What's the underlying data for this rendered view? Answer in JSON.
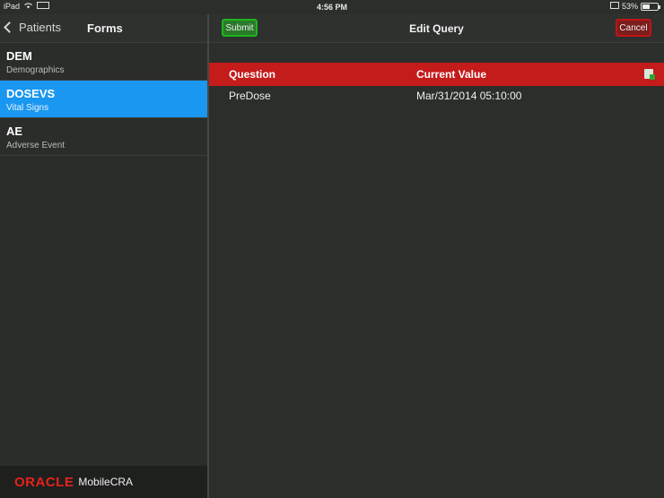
{
  "status_bar": {
    "device": "iPad",
    "time": "4:56 PM",
    "battery": "53%",
    "battery_level": 0.53
  },
  "left_panel": {
    "back_label": "Patients",
    "title": "Forms",
    "forms": [
      {
        "code": "DEM",
        "description": "Demographics",
        "selected": false
      },
      {
        "code": "DOSEVS",
        "description": "Vital Signs",
        "selected": true
      },
      {
        "code": "AE",
        "description": "Adverse Event",
        "selected": false
      }
    ],
    "brand": {
      "company": "ORACLE",
      "product": "MobileCRA"
    }
  },
  "right_panel": {
    "title": "Edit Query",
    "submit_label": "Submit",
    "cancel_label": "Cancel",
    "table": {
      "headers": {
        "question": "Question",
        "current_value": "Current Value"
      },
      "rows": [
        {
          "question": "PreDose",
          "value": "Mar/31/2014 05:10:00"
        }
      ]
    }
  },
  "colors": {
    "selected": "#1a97f0",
    "header_red": "#c41b1b",
    "submit_green": "#1eb51e",
    "cancel_red": "#c01515",
    "oracle_red": "#e5231b"
  }
}
